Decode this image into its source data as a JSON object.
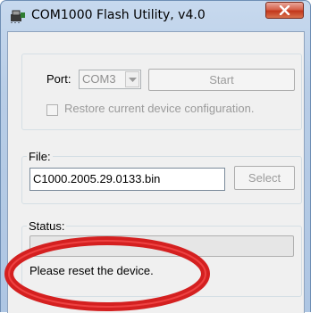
{
  "window": {
    "title": "COM1000 Flash Utility, v4.0",
    "icons": {
      "app": "flash-chip-icon",
      "close": "close-icon"
    }
  },
  "port_group": {
    "port_label": "Port:",
    "port_value": "COM3",
    "start_label": "Start",
    "restore_label": "Restore current device configuration.",
    "restore_checked": false
  },
  "file_group": {
    "legend": "File:",
    "file_value": "C1000.2005.29.0133.bin",
    "select_label": "Select"
  },
  "status_group": {
    "legend": "Status:",
    "progress": 0,
    "message": "Please reset the device."
  },
  "colors": {
    "annotation": "#d42020",
    "progress_fill": "#06b025"
  }
}
